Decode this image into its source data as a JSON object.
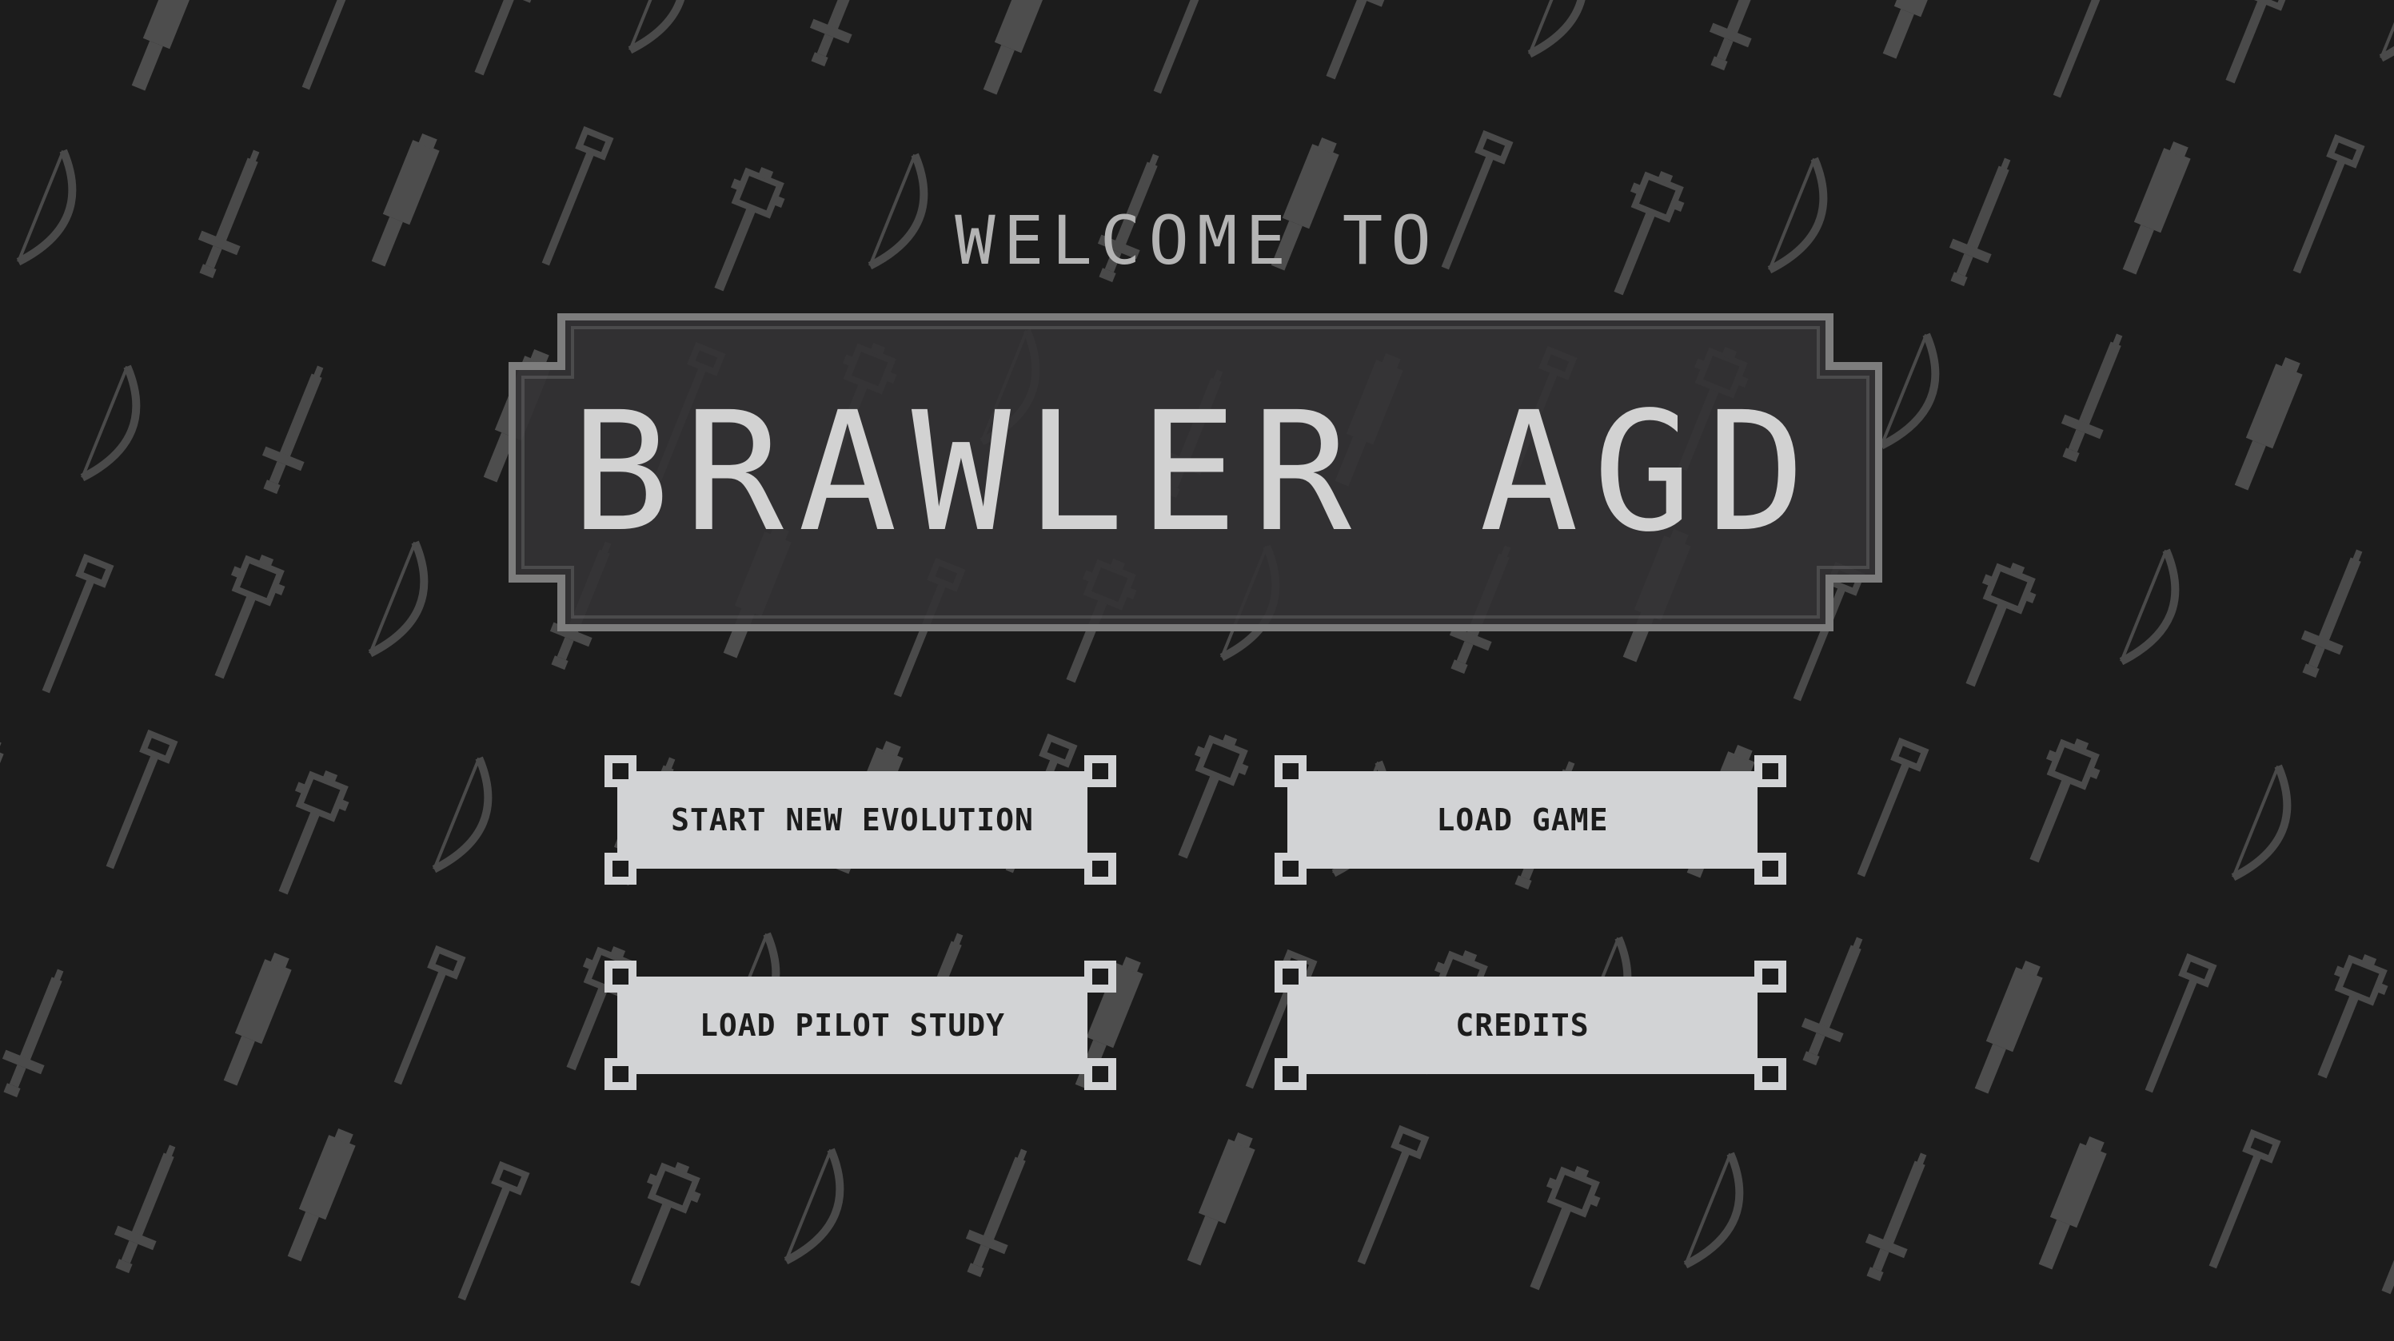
{
  "header": {
    "welcome": "WELCOME TO",
    "title": "BRAWLER AGD"
  },
  "menu": {
    "start_new_evolution": "START NEW EVOLUTION",
    "load_game": "LOAD GAME",
    "load_pilot_study": "LOAD PILOT STUDY",
    "credits": "CREDITS"
  },
  "background": {
    "pattern": "pixel-weapon-tiles",
    "icons": [
      "sword-icon",
      "mace-icon",
      "club-icon",
      "bow-icon",
      "staff-icon"
    ]
  },
  "colors": {
    "background": "#1c1c1c",
    "pattern": "#4a4a4a",
    "plate_fill": "#333234",
    "plate_border": "#7d7d7d",
    "button_face": "#d2d3d5",
    "button_text": "#1c1c1c",
    "title_text": "#d2d2d2",
    "welcome_text": "#b4b4b4"
  }
}
